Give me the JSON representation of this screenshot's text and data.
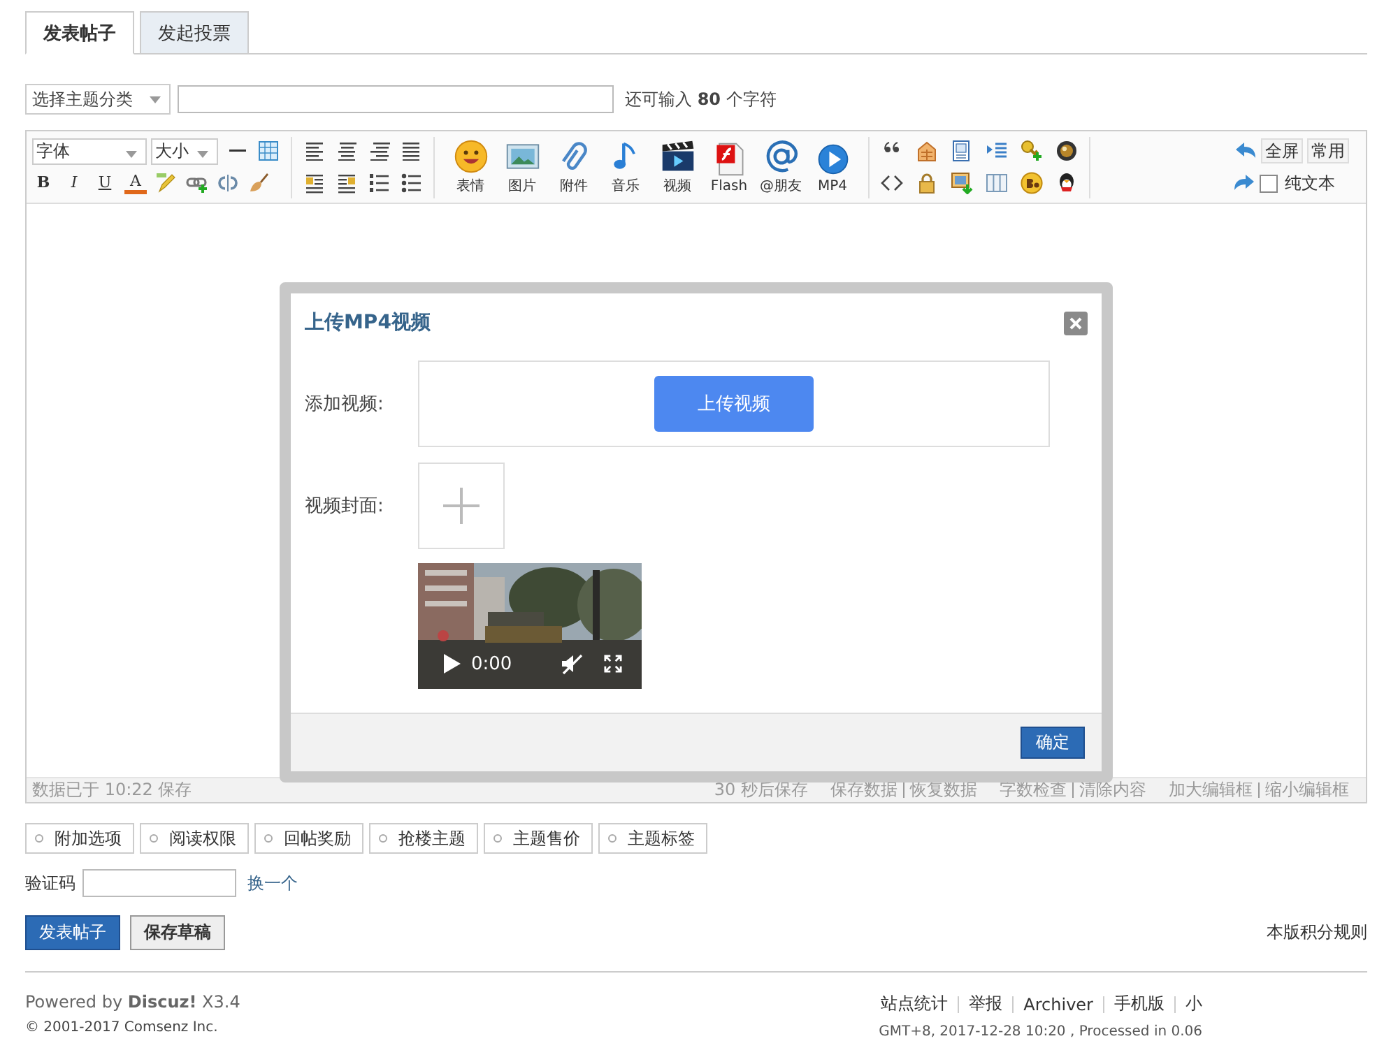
{
  "tabs": [
    {
      "label": "发表帖子",
      "selected": true
    },
    {
      "label": "发起投票",
      "selected": false
    }
  ],
  "title_row": {
    "category": "选择主题分类",
    "char_hint": "还可输入 **80** 个字符"
  },
  "toolbar": {
    "font": "字体",
    "size": "大小",
    "format_keys": [
      "B",
      "I",
      "U",
      "A"
    ],
    "media_buttons": [
      "表情",
      "图片",
      "附件",
      "音乐",
      "视频",
      "Flash",
      "@朋友",
      "MP4"
    ],
    "fullscreen": "全屏",
    "common": "常用",
    "plain_text": {
      "label": "纯文本",
      "checked": false
    }
  },
  "status_bar": {
    "saved": "数据已于 10:22 保存",
    "autosave": "30 秒后保存",
    "link_groups": [
      [
        "保存数据",
        "恢复数据"
      ],
      [
        "字数检查",
        "清除内容"
      ],
      [
        "加大编辑框",
        "缩小编辑框"
      ]
    ]
  },
  "dialog": {
    "title": "上传MP4视频",
    "add_label": "添加视频:",
    "upload_button": "上传视频",
    "cover_label": "视频封面:",
    "video_time": "0:00",
    "ok_button": "确定"
  },
  "options": [
    "附加选项",
    "阅读权限",
    "回帖奖励",
    "抢楼主题",
    "主题售价",
    "主题标签"
  ],
  "captcha": {
    "label": "验证码",
    "refresh_link": "换一个"
  },
  "buttons": {
    "submit": "发表帖子",
    "save_draft": "保存草稿"
  },
  "rules_link": "本版积分规则",
  "footer": {
    "powered": "Powered by **Discuz!** X3.4",
    "copyright": "© 2001-2017 Comsenz Inc.",
    "links": [
      "站点统计",
      "举报",
      "Archiver",
      "手机版",
      "小"
    ],
    "server_info": "GMT+8, 2017-12-28 10:20 , Processed in 0.06"
  }
}
